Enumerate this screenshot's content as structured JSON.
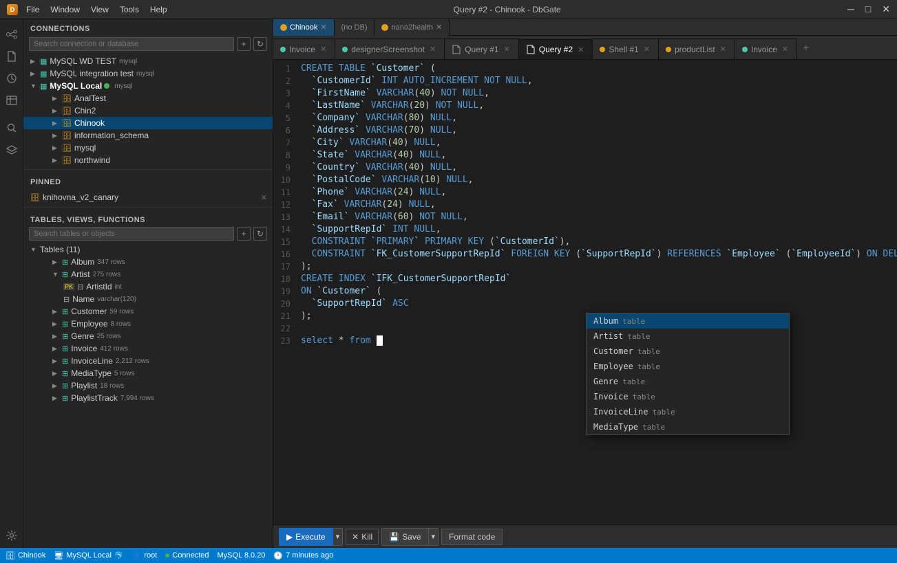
{
  "titlebar": {
    "title": "Query #2 - Chinook - DbGate",
    "menus": [
      "File",
      "Window",
      "View",
      "Tools",
      "Help"
    ],
    "buttons": [
      "─",
      "□",
      "✕"
    ]
  },
  "app_icon": "D",
  "connections": {
    "header": "CONNECTIONS",
    "search_placeholder": "Search connection or database",
    "items": [
      {
        "label": "MySQL WD TEST",
        "sublabel": "mysql",
        "type": "db"
      },
      {
        "label": "MySQL integration test",
        "sublabel": "mysql",
        "type": "db"
      },
      {
        "label": "MySQL Local",
        "sublabel": "mysql",
        "type": "db",
        "active": true
      },
      {
        "label": "AnalTest",
        "sublabel": "",
        "type": "table"
      },
      {
        "label": "Chin2",
        "sublabel": "",
        "type": "table"
      },
      {
        "label": "Chinook",
        "sublabel": "",
        "type": "table",
        "selected": true
      },
      {
        "label": "information_schema",
        "sublabel": "",
        "type": "table"
      },
      {
        "label": "mysql",
        "sublabel": "",
        "type": "table"
      },
      {
        "label": "northwind",
        "sublabel": "",
        "type": "table"
      }
    ]
  },
  "pinned": {
    "header": "PINNED",
    "items": [
      {
        "label": "knihovna_v2_canary"
      }
    ]
  },
  "tables_section": {
    "header": "TABLES, VIEWS, FUNCTIONS",
    "search_placeholder": "Search tables or objects",
    "group_label": "Tables (11)",
    "tables": [
      {
        "name": "Album",
        "rows": "347 rows",
        "expanded": false
      },
      {
        "name": "Artist",
        "rows": "275 rows",
        "expanded": true,
        "columns": [
          {
            "name": "ArtistId",
            "type": "int",
            "pk": true
          },
          {
            "name": "Name",
            "type": "varchar(120)",
            "pk": false
          }
        ]
      },
      {
        "name": "Customer",
        "rows": "59 rows",
        "expanded": false
      },
      {
        "name": "Employee",
        "rows": "8 rows",
        "expanded": false
      },
      {
        "name": "Genre",
        "rows": "25 rows",
        "expanded": false
      },
      {
        "name": "Invoice",
        "rows": "412 rows",
        "expanded": false
      },
      {
        "name": "InvoiceLine",
        "rows": "2,212 rows",
        "expanded": false
      },
      {
        "name": "MediaType",
        "rows": "5 rows",
        "expanded": false
      },
      {
        "name": "Playlist",
        "rows": "18 rows",
        "expanded": false
      },
      {
        "name": "PlaylistTrack",
        "rows": "7,994 rows",
        "expanded": false
      }
    ]
  },
  "tabs": [
    {
      "id": "invoice",
      "label": "Invoice",
      "dot": "blue",
      "active": false,
      "closable": true
    },
    {
      "id": "designer",
      "label": "designerScreenshot",
      "dot": "blue",
      "active": false,
      "closable": true
    },
    {
      "id": "query1",
      "label": "Query #1",
      "dot": null,
      "active": false,
      "closable": true
    },
    {
      "id": "query2",
      "label": "Query #2",
      "dot": null,
      "active": true,
      "closable": true
    },
    {
      "id": "shell1",
      "label": "Shell #1",
      "dot": "orange",
      "active": false,
      "closable": true
    },
    {
      "id": "productList",
      "label": "productList",
      "dot": "orange",
      "active": false,
      "closable": true
    },
    {
      "id": "invoice2",
      "label": "Invoice",
      "dot": "blue",
      "active": false,
      "closable": true
    }
  ],
  "active_db": "Chinook",
  "editor": {
    "lines": [
      {
        "num": 1,
        "text": "CREATE TABLE `Customer` ("
      },
      {
        "num": 2,
        "text": "  `CustomerId` INT AUTO_INCREMENT NOT NULL,"
      },
      {
        "num": 3,
        "text": "  `FirstName` VARCHAR(40) NOT NULL,"
      },
      {
        "num": 4,
        "text": "  `LastName` VARCHAR(20) NOT NULL,"
      },
      {
        "num": 5,
        "text": "  `Company` VARCHAR(80) NULL,"
      },
      {
        "num": 6,
        "text": "  `Address` VARCHAR(70) NULL,"
      },
      {
        "num": 7,
        "text": "  `City` VARCHAR(40) NULL,"
      },
      {
        "num": 8,
        "text": "  `State` VARCHAR(40) NULL,"
      },
      {
        "num": 9,
        "text": "  `Country` VARCHAR(40) NULL,"
      },
      {
        "num": 10,
        "text": "  `PostalCode` VARCHAR(10) NULL,"
      },
      {
        "num": 11,
        "text": "  `Phone` VARCHAR(24) NULL,"
      },
      {
        "num": 12,
        "text": "  `Fax` VARCHAR(24) NULL,"
      },
      {
        "num": 13,
        "text": "  `Email` VARCHAR(60) NOT NULL,"
      },
      {
        "num": 14,
        "text": "  `SupportRepId` INT NULL,"
      },
      {
        "num": 15,
        "text": "  CONSTRAINT `PRIMARY` PRIMARY KEY (`CustomerId`),"
      },
      {
        "num": 16,
        "text": "  CONSTRAINT `FK_CustomerSupportRepId` FOREIGN KEY (`SupportRepId`) REFERENCES `Employee` (`EmployeeId`) ON DELETE NO ACTION ON UPDATE NO ACTION"
      },
      {
        "num": 17,
        "text": ");"
      },
      {
        "num": 18,
        "text": "CREATE INDEX `IFK_CustomerSupportRepId`"
      },
      {
        "num": 19,
        "text": "ON `Customer` ("
      },
      {
        "num": 20,
        "text": "  `SupportRepId` ASC"
      },
      {
        "num": 21,
        "text": ");"
      },
      {
        "num": 22,
        "text": ""
      },
      {
        "num": 23,
        "text": "select * from |"
      }
    ]
  },
  "autocomplete": {
    "items": [
      {
        "name": "Album",
        "type": "table",
        "selected": true
      },
      {
        "name": "Artist",
        "type": "table"
      },
      {
        "name": "Customer",
        "type": "table"
      },
      {
        "name": "Employee",
        "type": "table"
      },
      {
        "name": "Genre",
        "type": "table"
      },
      {
        "name": "Invoice",
        "type": "table"
      },
      {
        "name": "InvoiceLine",
        "type": "table"
      },
      {
        "name": "MediaType",
        "type": "table"
      }
    ]
  },
  "toolbar": {
    "execute_label": "Execute",
    "kill_label": "Kill",
    "save_label": "Save",
    "format_label": "Format code"
  },
  "statusbar": {
    "db_name": "Chinook",
    "connection": "MySQL Local",
    "user": "root",
    "status": "Connected",
    "version": "MySQL 8.0.20",
    "time_ago": "7 minutes ago"
  }
}
